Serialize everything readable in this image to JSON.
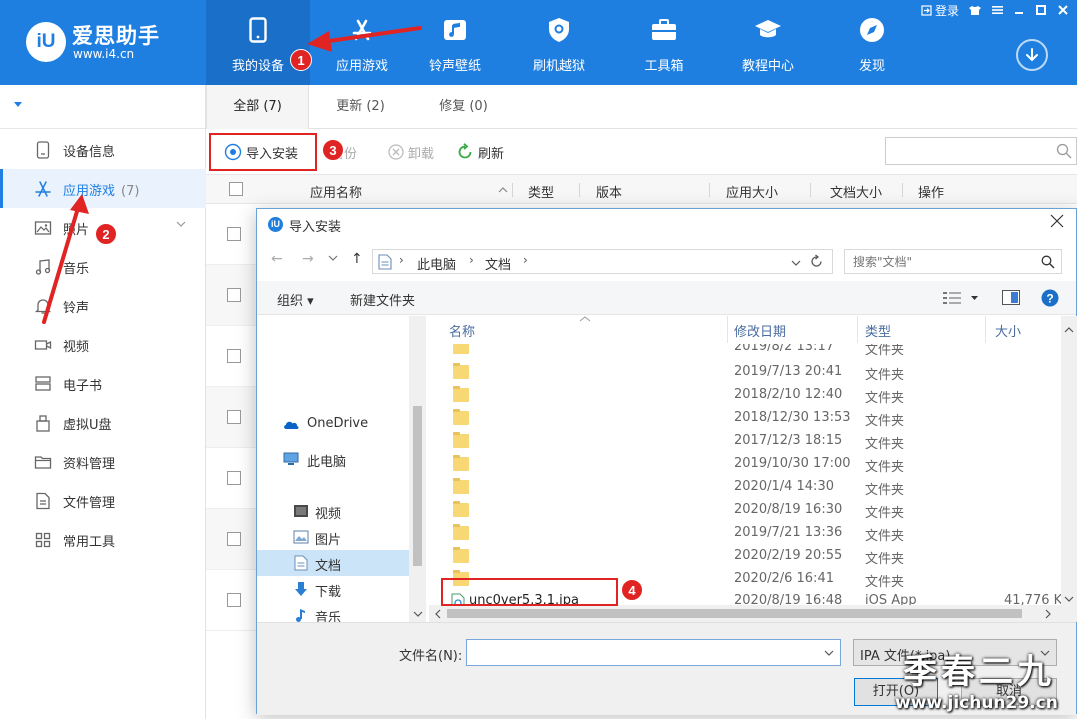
{
  "app": {
    "logo_mark": "iU",
    "name": "爱思助手",
    "url": "www.i4.cn",
    "login": "登录",
    "brand_color": "#1f7fe0"
  },
  "nav": [
    {
      "label": "我的设备",
      "icon": "phone-icon",
      "active": true
    },
    {
      "label": "应用游戏",
      "icon": "app-store-icon"
    },
    {
      "label": "铃声壁纸",
      "icon": "music-note-icon"
    },
    {
      "label": "刷机越狱",
      "icon": "shield-icon"
    },
    {
      "label": "工具箱",
      "icon": "toolbox-icon"
    },
    {
      "label": "教程中心",
      "icon": "graduation-cap-icon"
    },
    {
      "label": "发现",
      "icon": "compass-icon"
    }
  ],
  "sidebar": {
    "items": [
      {
        "label": "设备信息",
        "icon": "device-info-icon"
      },
      {
        "label": "应用游戏",
        "count": "(7)",
        "icon": "app-store-icon",
        "active": true
      },
      {
        "label": "照片",
        "icon": "photo-icon"
      },
      {
        "label": "音乐",
        "icon": "music-icon"
      },
      {
        "label": "铃声",
        "icon": "bell-icon"
      },
      {
        "label": "视频",
        "icon": "video-icon"
      },
      {
        "label": "电子书",
        "icon": "ebook-icon"
      },
      {
        "label": "虚拟U盘",
        "icon": "usb-icon"
      },
      {
        "label": "资料管理",
        "icon": "folder-icon"
      },
      {
        "label": "文件管理",
        "icon": "file-icon"
      },
      {
        "label": "常用工具",
        "icon": "grid-icon"
      }
    ]
  },
  "tabs": [
    {
      "label": "全部 (7)",
      "active": true
    },
    {
      "label": "更新 (2)"
    },
    {
      "label": "修复 (0)"
    }
  ],
  "toolbar": {
    "import": "导入安装",
    "backup": "备份",
    "uninstall": "卸载",
    "refresh": "刷新"
  },
  "table": {
    "headers": [
      "应用名称",
      "类型",
      "版本",
      "应用大小",
      "文档大小",
      "操作"
    ]
  },
  "dialog": {
    "title": "导入安装",
    "breadcrumb": [
      "此电脑",
      "文档"
    ],
    "search_placeholder": "搜索\"文档\"",
    "organize": "组织",
    "new_folder": "新建文件夹",
    "nav_pane": [
      {
        "label": "OneDrive",
        "icon": "cloud-icon"
      },
      {
        "label": "此电脑",
        "icon": "computer-icon"
      },
      {
        "label": "视频",
        "icon": "video-folder-icon"
      },
      {
        "label": "图片",
        "icon": "picture-folder-icon"
      },
      {
        "label": "文档",
        "icon": "document-folder-icon",
        "selected": true
      },
      {
        "label": "下载",
        "icon": "download-arrow-icon"
      },
      {
        "label": "音乐",
        "icon": "music-folder-icon"
      }
    ],
    "columns": [
      "名称",
      "修改日期",
      "类型",
      "大小"
    ],
    "partial_date": "2019/8/2 13:17",
    "partial_type": "文件夹",
    "folders": [
      {
        "date": "2019/7/13 20:41",
        "type": "文件夹"
      },
      {
        "date": "2018/2/10 12:40",
        "type": "文件夹"
      },
      {
        "date": "2018/12/30 13:53",
        "type": "文件夹"
      },
      {
        "date": "2017/12/3 18:15",
        "type": "文件夹"
      },
      {
        "date": "2019/10/30 17:00",
        "type": "文件夹"
      },
      {
        "date": "2020/1/4 14:30",
        "type": "文件夹"
      },
      {
        "date": "2020/8/19 16:30",
        "type": "文件夹"
      },
      {
        "date": "2019/7/21 13:36",
        "type": "文件夹"
      },
      {
        "date": "2020/2/19 20:55",
        "type": "文件夹"
      },
      {
        "date": "2020/2/6 16:41",
        "type": "文件夹"
      }
    ],
    "ipa_file": {
      "name": "unc0ver5.3.1.ipa",
      "date": "2020/8/19 16:48",
      "type": "iOS App",
      "size": "41,776 K"
    },
    "filename_label": "文件名(N):",
    "filename_value": "",
    "filetype": "IPA 文件(*.ipa)",
    "open": "打开(O)",
    "cancel": "取消"
  },
  "annotations": {
    "b1": "1",
    "b2": "2",
    "b3": "3",
    "b4": "4",
    "color": "#e02424"
  },
  "watermark": {
    "text": "季春二九",
    "url": "www.jichun29.cn"
  }
}
